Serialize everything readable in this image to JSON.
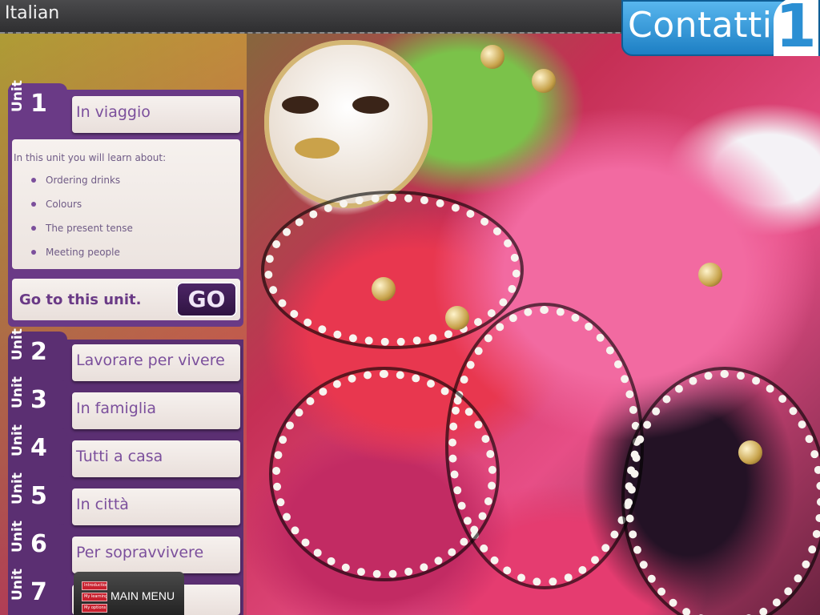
{
  "app": {
    "title": "Italian"
  },
  "brand": {
    "name": "Contatti",
    "number": "1"
  },
  "units": [
    {
      "word": "Unit",
      "number": "1",
      "title": "In viaggio",
      "expanded": true
    },
    {
      "word": "Unit",
      "number": "2",
      "title": "Lavorare per vivere"
    },
    {
      "word": "Unit",
      "number": "3",
      "title": "In famiglia"
    },
    {
      "word": "Unit",
      "number": "4",
      "title": "Tutti a casa"
    },
    {
      "word": "Unit",
      "number": "5",
      "title": "In città"
    },
    {
      "word": "Unit",
      "number": "6",
      "title": "Per sopravvivere"
    },
    {
      "word": "Unit",
      "number": "7",
      "title": ""
    }
  ],
  "unit_detail": {
    "intro": "In this unit you will learn about:",
    "topics": [
      "Ordering drinks",
      "Colours",
      "The present tense",
      "Meeting people"
    ],
    "go_prompt": "Go to this unit.",
    "go_label": "GO"
  },
  "main_menu": {
    "label": "MAIN MENU",
    "icon_items": [
      "Introduction",
      "My learning",
      "My options"
    ]
  },
  "colors": {
    "accent_purple": "#6a3a86",
    "unit_text": "#7b4f9c",
    "brand_blue": "#2b8fd3"
  }
}
